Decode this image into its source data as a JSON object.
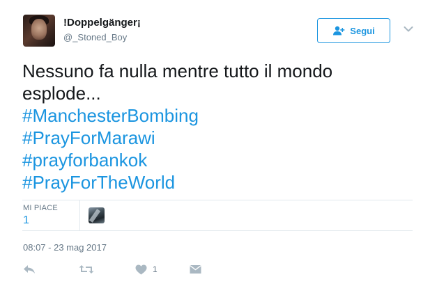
{
  "user": {
    "display_name": "!Doppelgänger¡",
    "username": "@_Stoned_Boy"
  },
  "follow_button": {
    "label": "Segui"
  },
  "tweet": {
    "text_lines": [
      "Nessuno fa nulla mentre tutto il mondo",
      "esplode..."
    ],
    "hashtags": [
      "#ManchesterBombing",
      "#PrayForMarawi",
      "#prayforbankok",
      "#PrayForTheWorld"
    ]
  },
  "stats": {
    "likes_label": "MI PIACE",
    "likes_value": "1"
  },
  "timestamp": "08:07 - 23 mag 2017",
  "actions": {
    "like_count": "1"
  },
  "colors": {
    "accent": "#1b95e0",
    "text": "#14171a",
    "muted": "#657786",
    "icon": "#aab8c2"
  }
}
